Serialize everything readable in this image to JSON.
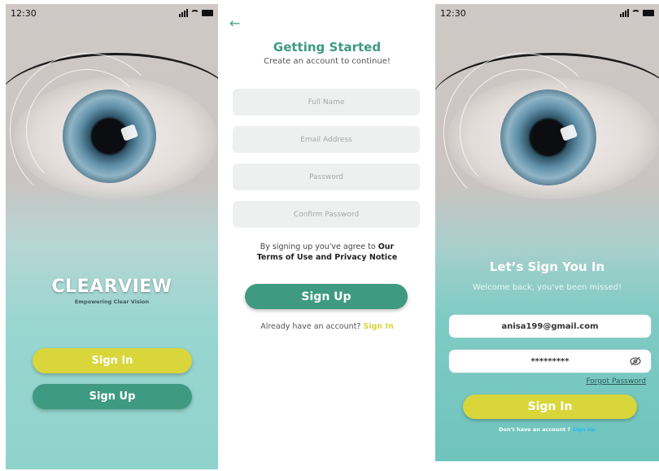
{
  "status": {
    "time": "12:30"
  },
  "welcome": {
    "brand": "CLEARVIEW",
    "tagline": "Empowering Clear Vision",
    "sign_in_label": "Sign In",
    "sign_up_label": "Sign Up"
  },
  "signup": {
    "title": "Getting Started",
    "subtitle": "Create an account to continue!",
    "full_name_placeholder": "Full Name",
    "email_placeholder": "Email Address",
    "password_placeholder": "Password",
    "confirm_password_placeholder": "Confirm Password",
    "terms_prefix": "By signing up you've agree to",
    "terms_bold_1": "Our",
    "terms_bold_2": "Terms of Use and Privacy Notice",
    "submit_label": "Sign Up",
    "already_text": "Already have an account?",
    "already_link": "Sign In"
  },
  "signin": {
    "title": "Let’s Sign  You In",
    "subtitle": "Welcome back, you've been missed!",
    "email_value": "anisa199@gmail.com",
    "password_value": "*********",
    "forgot_label": "Forgot Password",
    "submit_label": "Sign In",
    "no_account_text": "Don't have an account ?",
    "no_account_link": "Sign Up"
  },
  "icons": {
    "back": "arrow-left-icon",
    "signal": "signal-icon",
    "wifi": "wifi-icon",
    "battery": "battery-icon",
    "visibility_off": "eye-off-icon"
  },
  "colors": {
    "primary_green": "#3e9a80",
    "accent_yellow": "#d8d63b",
    "field_bg": "#eef0f0",
    "teal_bg": "#8fd3cc",
    "link_blue": "#29b6f6"
  }
}
